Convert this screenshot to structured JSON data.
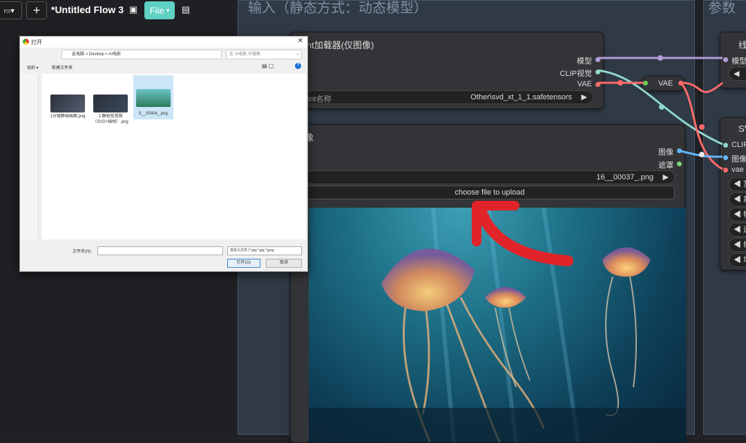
{
  "toolbar": {
    "folder_icon": "folder-icon",
    "add_label": "+",
    "flow_title": "*Untitled Flow 3",
    "file_label": "File",
    "image_icon": "image-icon",
    "save_icon": "save-icon"
  },
  "groups": {
    "left_title": "输入（静态方式：动态模型）",
    "right_title": "参数"
  },
  "checkpoint_node": {
    "title": "ckpt加载器(仅图像)",
    "title_visible": "int加载器(仅图像)",
    "outputs": [
      "模型",
      "CLIP视觉",
      "VAE"
    ],
    "widget_label": "int名称",
    "widget_value": "Other\\svd_xt_1_1.safetensors"
  },
  "image_node": {
    "outputs": [
      "图像",
      "遮罩"
    ],
    "widget_value": "16__00037_.png",
    "upload_button": "choose file to upload"
  },
  "vae_reroute": {
    "label": "VAE"
  },
  "right_nodes": {
    "top_title": "线",
    "top_input": "模型",
    "svd_title": "SV",
    "svd_inputs": [
      "CLIP",
      "图像",
      "vae"
    ],
    "widget_arrows": [
      "◀ 宽",
      "◀ 高",
      "◀ 帧",
      "◀ 运",
      "◀ 帧",
      "◀ 增"
    ]
  },
  "dialog": {
    "title": "打开",
    "breadcrumb": [
      "此电脑",
      "Desktop",
      "AI电影"
    ],
    "search_placeholder": "在 AI电影 中搜索",
    "organize_label": "组织 ▾",
    "new_folder_label": "新建文件夹",
    "files": [
      {
        "name": "1分镜静帧画面.png"
      },
      {
        "name": "2.静帧变视频（SVD+插帧）.png"
      },
      {
        "name": "5__00004_.png"
      }
    ],
    "filename_label": "文件名(N):",
    "filetype_value": "自定义文件 (*.jpg;*.jpg;*.jpeg",
    "open_button": "打开(O)",
    "cancel_button": "取消"
  },
  "colors": {
    "accent_teal": "#5fd1c4",
    "vae_red": "#ff6b6b",
    "model_purple": "#b39ddb",
    "clip_teal": "#8fd6cc",
    "arrow_red": "#e0242a"
  }
}
